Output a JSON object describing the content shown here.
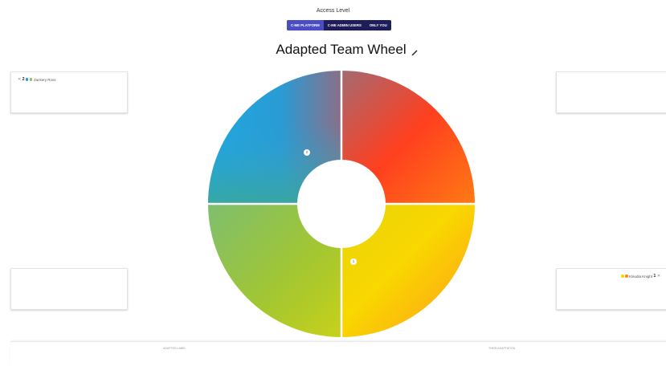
{
  "access": {
    "title": "Access Level",
    "options": [
      {
        "label": "C-ME PLATFORM",
        "active": true
      },
      {
        "label": "C-ME ADMIN USERS",
        "active": false
      },
      {
        "label": "ONLY YOU",
        "active": false
      }
    ]
  },
  "wheel": {
    "title": "Adapted Team Wheel",
    "quadrant_colors": {
      "top_left": [
        "#1e9ad6",
        "#8a6f87"
      ],
      "top_right": [
        "#a46a73",
        "#ff4a1c"
      ],
      "bottom_left": [
        "#8fbf5a",
        "#b8cf22"
      ],
      "bottom_right": [
        "#f7d800",
        "#ff8a1c"
      ]
    },
    "markers": [
      {
        "label": "2"
      },
      {
        "label": "1"
      }
    ]
  },
  "panels": {
    "top_left": {
      "member_name": "Zackery Ross",
      "rank": "2"
    },
    "bottom_right": {
      "member_name": "Klaudia Knight",
      "rank": "1"
    }
  },
  "bottom": {
    "left_label": "ADAPTED LABEL",
    "right_label": "THEIR ADAPTATION"
  }
}
